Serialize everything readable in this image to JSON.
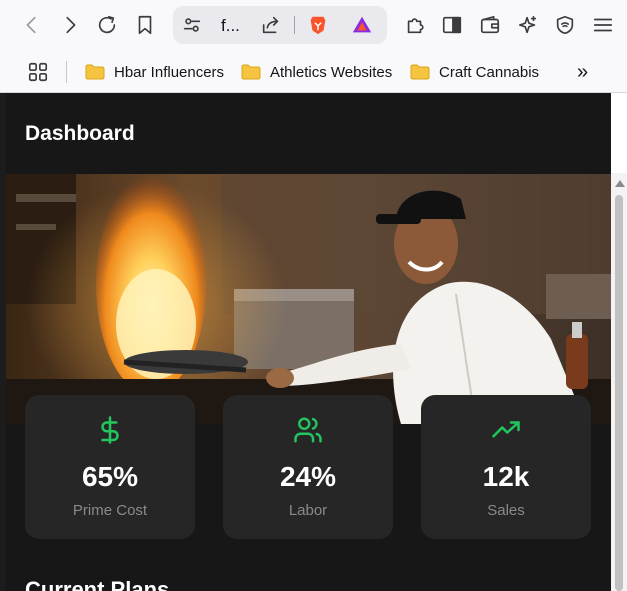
{
  "browser": {
    "url_fragment": "f...",
    "bookmarks": [
      {
        "label": "Hbar Influencers"
      },
      {
        "label": "Athletics Websites"
      },
      {
        "label": "Craft Cannabis"
      }
    ],
    "overflow_label": "»"
  },
  "app": {
    "title": "Dashboard",
    "hero_image": "chef-flaming-pan",
    "stats": [
      {
        "icon": "dollar-icon",
        "value": "65%",
        "label": "Prime Cost"
      },
      {
        "icon": "users-icon",
        "value": "24%",
        "label": "Labor"
      },
      {
        "icon": "trending-up-icon",
        "value": "12k",
        "label": "Sales"
      }
    ],
    "section_title": "Current Plans"
  },
  "colors": {
    "accent": "#22c55e",
    "app_bg": "#171717",
    "card_bg": "#262626",
    "muted_text": "#8a8a8a"
  }
}
